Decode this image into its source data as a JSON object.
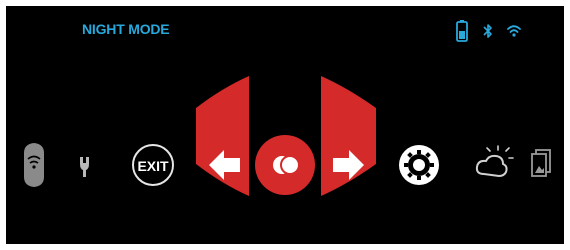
{
  "app": {
    "mode_title": "NIGHT MODE"
  },
  "status": {
    "battery_icon": "battery-icon",
    "bluetooth_icon": "bluetooth-icon",
    "wifi_icon": "wifi-icon"
  },
  "menu": {
    "exit_label": "EXIT",
    "items": [
      {
        "name": "wifi-stream-icon",
        "kind": "icon"
      },
      {
        "name": "wrench-icon",
        "kind": "icon"
      },
      {
        "name": "exit-button",
        "kind": "button"
      },
      {
        "name": "arrow-left-icon",
        "kind": "nav"
      },
      {
        "name": "mode-toggle-icon",
        "kind": "selected"
      },
      {
        "name": "arrow-right-icon",
        "kind": "nav"
      },
      {
        "name": "settings-gear-icon",
        "kind": "icon"
      },
      {
        "name": "day-night-icon",
        "kind": "icon"
      },
      {
        "name": "gallery-icon",
        "kind": "icon"
      }
    ]
  },
  "colors": {
    "accent": "#29a8dc",
    "selector_red": "#d42a2a",
    "icon_gray": "#a8a8a8",
    "background": "#000000"
  }
}
